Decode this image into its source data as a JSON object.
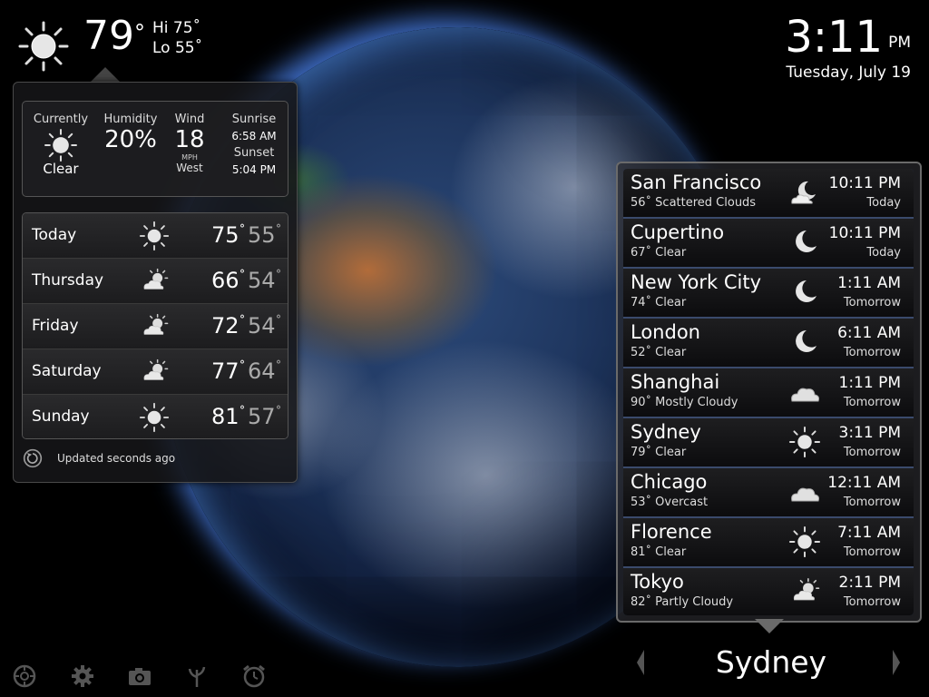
{
  "current": {
    "temp": "79",
    "deg": "°",
    "hi": "Hi 75˚",
    "lo": "Lo 55˚",
    "icon": "sun-icon"
  },
  "clock": {
    "time": "3:11",
    "ampm": "PM",
    "date": "Tuesday, July 19"
  },
  "conditions": {
    "currently_label": "Currently",
    "currently_value": "Clear",
    "humidity_label": "Humidity",
    "humidity_value": "20%",
    "wind_label": "Wind",
    "wind_value": "18",
    "wind_unit": "MPH",
    "wind_dir": "West",
    "sunrise_label": "Sunrise",
    "sunrise_value": "6:58 AM",
    "sunset_label": "Sunset",
    "sunset_value": "5:04 PM"
  },
  "forecast": [
    {
      "day": "Today",
      "icon": "sun-icon",
      "hi": "75",
      "lo": "55"
    },
    {
      "day": "Thursday",
      "icon": "partly-cloudy-icon",
      "hi": "66",
      "lo": "54"
    },
    {
      "day": "Friday",
      "icon": "partly-cloudy-icon",
      "hi": "72",
      "lo": "54"
    },
    {
      "day": "Saturday",
      "icon": "partly-cloudy-icon",
      "hi": "77",
      "lo": "64"
    },
    {
      "day": "Sunday",
      "icon": "sun-icon",
      "hi": "81",
      "lo": "57"
    }
  ],
  "deg_symbol": "˚",
  "updated": "Updated seconds ago",
  "cities": [
    {
      "name": "San Francisco",
      "desc": "56˚ Scattered Clouds",
      "time": "10:11 PM",
      "day": "Today",
      "icon": "moon-cloud-icon"
    },
    {
      "name": "Cupertino",
      "desc": "67˚ Clear",
      "time": "10:11 PM",
      "day": "Today",
      "icon": "moon-icon"
    },
    {
      "name": "New York City",
      "desc": "74˚ Clear",
      "time": "1:11 AM",
      "day": "Tomorrow",
      "icon": "moon-icon"
    },
    {
      "name": "London",
      "desc": "52˚ Clear",
      "time": "6:11 AM",
      "day": "Tomorrow",
      "icon": "moon-icon"
    },
    {
      "name": "Shanghai",
      "desc": "90˚ Mostly Cloudy",
      "time": "1:11 PM",
      "day": "Tomorrow",
      "icon": "cloud-icon"
    },
    {
      "name": "Sydney",
      "desc": "79˚ Clear",
      "time": "3:11 PM",
      "day": "Tomorrow",
      "icon": "sun-icon"
    },
    {
      "name": "Chicago",
      "desc": "53˚ Overcast",
      "time": "12:11 AM",
      "day": "Tomorrow",
      "icon": "cloud-icon"
    },
    {
      "name": "Florence",
      "desc": "81˚ Clear",
      "time": "7:11 AM",
      "day": "Tomorrow",
      "icon": "sun-icon"
    },
    {
      "name": "Tokyo",
      "desc": "82˚ Partly Cloudy",
      "time": "2:11 PM",
      "day": "Tomorrow",
      "icon": "partly-cloudy-icon"
    }
  ],
  "selected_city": "Sydney",
  "toolbar": [
    {
      "name": "globe-icon"
    },
    {
      "name": "gear-icon"
    },
    {
      "name": "camera-icon"
    },
    {
      "name": "plant-icon"
    },
    {
      "name": "alarm-clock-icon"
    }
  ]
}
